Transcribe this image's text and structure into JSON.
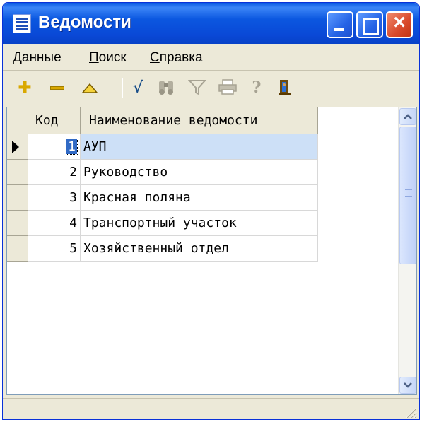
{
  "window": {
    "title": "Ведомости"
  },
  "menu": [
    {
      "label": "Данные"
    },
    {
      "label": "Поиск"
    },
    {
      "label": "Справка"
    }
  ],
  "toolbar": {
    "buttons": [
      {
        "icon": "plus-icon",
        "color": "#d9a800"
      },
      {
        "icon": "minus-icon",
        "color": "#d9a800"
      },
      {
        "icon": "triangle-up-icon",
        "color": "#d9a800"
      },
      {
        "icon": "checkmark-icon",
        "color": "#1a4f8a"
      },
      {
        "icon": "binoculars-icon",
        "color": "#a7a393"
      },
      {
        "icon": "filter-icon",
        "color": "#a7a393"
      },
      {
        "icon": "printer-icon",
        "color": "#a7a393"
      },
      {
        "icon": "help-icon",
        "color": "#a7a393"
      },
      {
        "icon": "exit-icon",
        "color": "#5a3a00"
      }
    ]
  },
  "grid": {
    "columns": [
      "Код",
      "Наименование ведомости"
    ],
    "rows": [
      {
        "code": "1",
        "name": "АУП",
        "selected": true
      },
      {
        "code": "2",
        "name": "Руководство"
      },
      {
        "code": "3",
        "name": "Красная поляна"
      },
      {
        "code": "4",
        "name": "Транспортный участок"
      },
      {
        "code": "5",
        "name": "Хозяйственный отдел"
      }
    ]
  },
  "colors": {
    "titlebar": "#0a5ae3",
    "selection": "#316ac5",
    "row_highlight": "#cde0f7"
  }
}
